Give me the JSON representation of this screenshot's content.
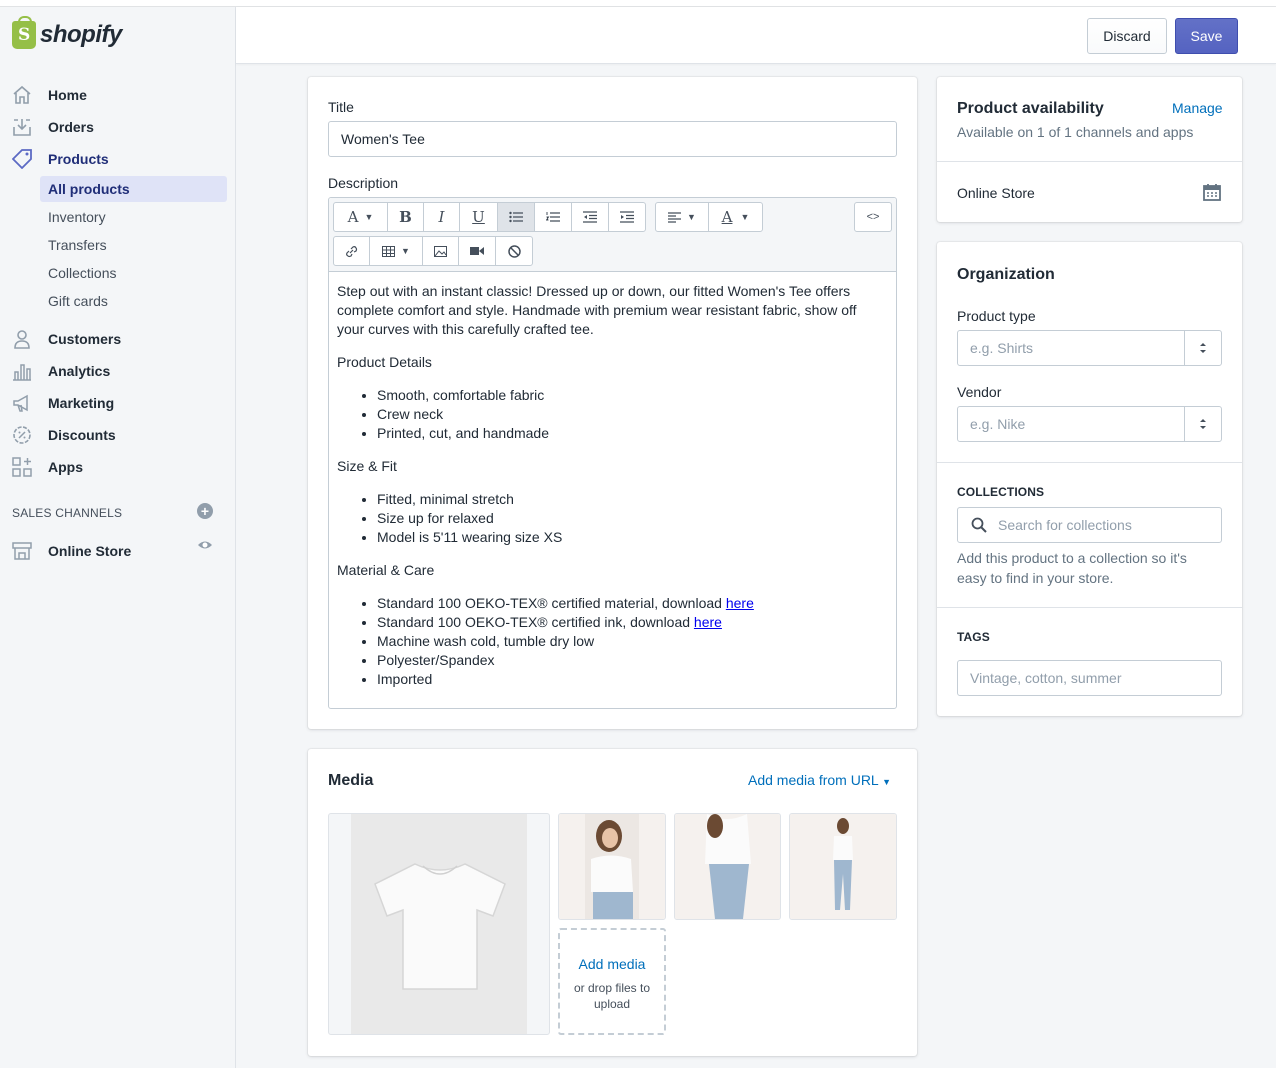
{
  "brand": {
    "name": "shopify"
  },
  "nav": {
    "main": [
      {
        "label": "Home",
        "icon": "home-icon"
      },
      {
        "label": "Orders",
        "icon": "orders-icon"
      },
      {
        "label": "Products",
        "icon": "tag-icon"
      }
    ],
    "product_sub": [
      "All products",
      "Inventory",
      "Transfers",
      "Collections",
      "Gift cards"
    ],
    "more": [
      {
        "label": "Customers",
        "icon": "person-icon"
      },
      {
        "label": "Analytics",
        "icon": "bar-chart-icon"
      },
      {
        "label": "Marketing",
        "icon": "megaphone-icon"
      },
      {
        "label": "Discounts",
        "icon": "discount-icon"
      },
      {
        "label": "Apps",
        "icon": "apps-icon"
      }
    ],
    "sales_channels_header": "SALES CHANNELS",
    "online_store": "Online Store"
  },
  "topbar": {
    "discard_label": "Discard",
    "save_label": "Save"
  },
  "product": {
    "title_label": "Title",
    "title_value": "Women's Tee",
    "description_label": "Description",
    "intro": "Step out with an instant classic! Dressed up or down, our fitted Women's Tee offers complete comfort and style. Handmade with premium wear resistant fabric, show off your curves with this carefully crafted tee.",
    "details_heading": "Product Details",
    "details": [
      "Smooth, comfortable fabric",
      "Crew neck",
      "Printed, cut, and handmade"
    ],
    "size_heading": "Size & Fit",
    "size": [
      "Fitted, minimal stretch",
      "Size up for relaxed",
      "Model is 5'11 wearing size XS"
    ],
    "material_heading": "Material & Care",
    "material_1_text": "Standard 100 OEKO-TEX® certified material, download ",
    "material_2_text": "Standard 100 OEKO-TEX® certified ink, download ",
    "here_link": "here",
    "material_rest": [
      "Machine wash cold, tumble dry low",
      "Polyester/Spandex",
      "Imported"
    ]
  },
  "media": {
    "title": "Media",
    "add_url": "Add media from URL",
    "add_media": "Add media",
    "drop_hint": "or drop files to upload"
  },
  "availability": {
    "title": "Product availability",
    "manage": "Manage",
    "subtitle": "Available on 1 of 1 channels and apps",
    "channel": "Online Store"
  },
  "organization": {
    "title": "Organization",
    "type_label": "Product type",
    "type_placeholder": "e.g. Shirts",
    "vendor_label": "Vendor",
    "vendor_placeholder": "e.g. Nike",
    "collections_header": "COLLECTIONS",
    "collections_placeholder": "Search for collections",
    "collections_help": "Add this product to a collection so it's easy to find in your store.",
    "tags_header": "TAGS",
    "tags_placeholder": "Vintage, cotton, summer"
  },
  "colors": {
    "accent": "#5c6ac4",
    "link": "#006fbb",
    "logo_green": "#95bf47"
  }
}
